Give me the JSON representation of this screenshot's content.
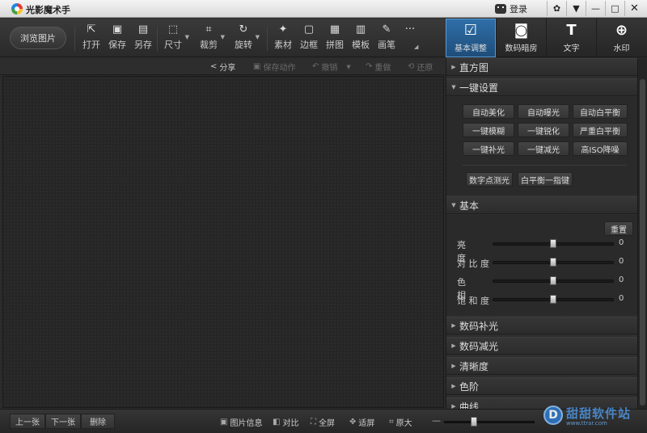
{
  "title": "光影魔术手",
  "titlebar": {
    "login_label": "登录",
    "buttons": [
      "✿",
      "▼",
      "—",
      "□",
      "✕"
    ]
  },
  "toolbar": {
    "browse_label": "浏览图片",
    "tools": [
      {
        "name": "open",
        "label": "打开",
        "icon": "⇱"
      },
      {
        "name": "save",
        "label": "保存",
        "icon": "▣"
      },
      {
        "name": "save-as",
        "label": "另存",
        "icon": "▤"
      },
      {
        "name": "size",
        "label": "尺寸",
        "icon": "⬚"
      },
      {
        "name": "crop",
        "label": "裁剪",
        "icon": "⌗"
      },
      {
        "name": "rotate",
        "label": "旋转",
        "icon": "↻"
      },
      {
        "name": "material",
        "label": "素材",
        "icon": "✦"
      },
      {
        "name": "border",
        "label": "边框",
        "icon": "▢"
      },
      {
        "name": "collage",
        "label": "拼图",
        "icon": "▦"
      },
      {
        "name": "template",
        "label": "模板",
        "icon": "▥"
      },
      {
        "name": "brush",
        "label": "画笔",
        "icon": "✎"
      }
    ],
    "more_icon": "···"
  },
  "right_tabs": [
    {
      "label": "基本调整",
      "icon": "☑",
      "active": true
    },
    {
      "label": "数码暗房",
      "icon": "◙",
      "active": false
    },
    {
      "label": "文字",
      "icon": "T",
      "active": false
    },
    {
      "label": "水印",
      "icon": "⊕",
      "active": false
    }
  ],
  "subbar": {
    "share": "分享",
    "save_action": "保存动作",
    "undo": "撤销",
    "redo": "重做",
    "restore": "还原"
  },
  "panel": {
    "histogram": "直方图",
    "one_click": {
      "title": "一键设置",
      "buttons": [
        "自动美化",
        "自动曝光",
        "自动白平衡",
        "一键模糊",
        "一键锐化",
        "严重白平衡",
        "一键补光",
        "一键减光",
        "高ISO降噪"
      ],
      "extra": [
        "数字点测光",
        "白平衡一指键"
      ]
    },
    "basic": {
      "title": "基本",
      "reset": "重置",
      "sliders": [
        {
          "label": "亮　　度",
          "value": 0
        },
        {
          "label": "对 比 度",
          "value": 0
        },
        {
          "label": "色　　相",
          "value": 0
        },
        {
          "label": "饱 和 度",
          "value": 0
        }
      ]
    },
    "sections": [
      "数码补光",
      "数码减光",
      "清晰度",
      "色阶",
      "曲线"
    ]
  },
  "bottom": {
    "prev": "上一张",
    "next": "下一张",
    "delete": "删除",
    "info": "图片信息",
    "compare": "对比",
    "fullscreen": "全屏",
    "fit": "适屏",
    "original": "原大"
  },
  "watermark": {
    "name": "甜甜软件站",
    "url": "www.ttrar.com"
  }
}
